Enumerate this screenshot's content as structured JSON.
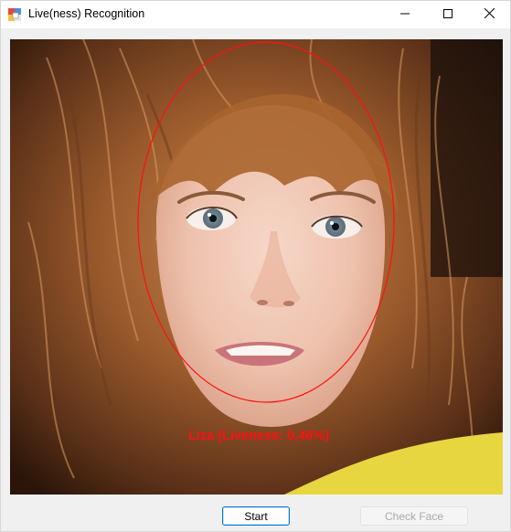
{
  "window": {
    "title": "Live(ness) Recognition",
    "icons": {
      "app": "app-icon",
      "minimize": "minimize-icon",
      "maximize": "maximize-icon",
      "close": "close-icon"
    }
  },
  "video": {
    "face_label": "Liza (Liveness: 0,46%)",
    "face_marker_color": "#ff1010"
  },
  "buttons": {
    "start_label": "Start",
    "check_face_label": "Check Face"
  },
  "colors": {
    "accent": "#0078d4",
    "label": "#ff1010"
  }
}
